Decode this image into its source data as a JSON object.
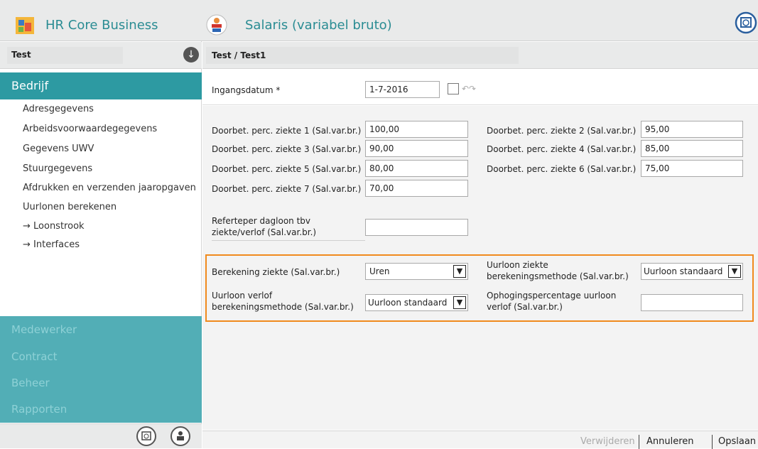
{
  "app": {
    "title": "HR Core Business"
  },
  "module": {
    "title": "Salaris (variabel bruto)"
  },
  "environment": {
    "name": "Test"
  },
  "breadcrumb": "Test / Test1",
  "sidebar": {
    "active_section": "Bedrijf",
    "items": [
      "Adresgegevens",
      "Arbeidsvoorwaardegegevens",
      "Gegevens UWV",
      "Stuurgegevens",
      "Afdrukken en verzenden jaaropgaven",
      "Uurlonen berekenen"
    ],
    "sub_items": [
      "→ Loonstrook",
      "→ Interfaces"
    ],
    "sections": [
      "Medewerker",
      "Contract",
      "Beheer",
      "Rapporten"
    ]
  },
  "form": {
    "ingangsdatum_label": "Ingangsdatum *",
    "ingangsdatum_value": "1-7-2016",
    "fields": [
      {
        "label": "Doorbet. perc. ziekte 1 (Sal.var.br.)",
        "value": "100,00"
      },
      {
        "label": "Doorbet. perc. ziekte 2 (Sal.var.br.)",
        "value": "95,00"
      },
      {
        "label": "Doorbet. perc. ziekte 3 (Sal.var.br.)",
        "value": "90,00"
      },
      {
        "label": "Doorbet. perc. ziekte 4 (Sal.var.br.)",
        "value": "85,00"
      },
      {
        "label": "Doorbet. perc. ziekte 5 (Sal.var.br.)",
        "value": "80,00"
      },
      {
        "label": "Doorbet. perc. ziekte 6 (Sal.var.br.)",
        "value": "75,00"
      },
      {
        "label": "Doorbet. perc. ziekte 7 (Sal.var.br.)",
        "value": "70,00"
      }
    ],
    "referteper_label_1": "Referteper dagloon tbv",
    "referteper_label_2": "ziekte/verlof (Sal.var.br.)",
    "referteper_value": "",
    "berekening_ziekte_label": "Berekening ziekte (Sal.var.br.)",
    "berekening_ziekte_value": "Uren",
    "uurloon_ziekte_label_1": "Uurloon ziekte",
    "uurloon_ziekte_label_2": "berekeningsmethode (Sal.var.br.)",
    "uurloon_ziekte_value": "Uurloon standaard",
    "uurloon_verlof_label_1": "Uurloon verlof",
    "uurloon_verlof_label_2": "berekeningsmethode (Sal.var.br.)",
    "uurloon_verlof_value": "Uurloon standaard",
    "ophoging_label_1": "Ophogingspercentage uurloon",
    "ophoging_label_2": "verlof (Sal.var.br.)",
    "ophoging_value": ""
  },
  "actions": {
    "delete": "Verwijderen",
    "cancel": "Annuleren",
    "save": "Opslaan"
  },
  "colors": {
    "accent": "#2d9aa2",
    "section": "#52aeb6",
    "highlight": "#f08a1d"
  }
}
